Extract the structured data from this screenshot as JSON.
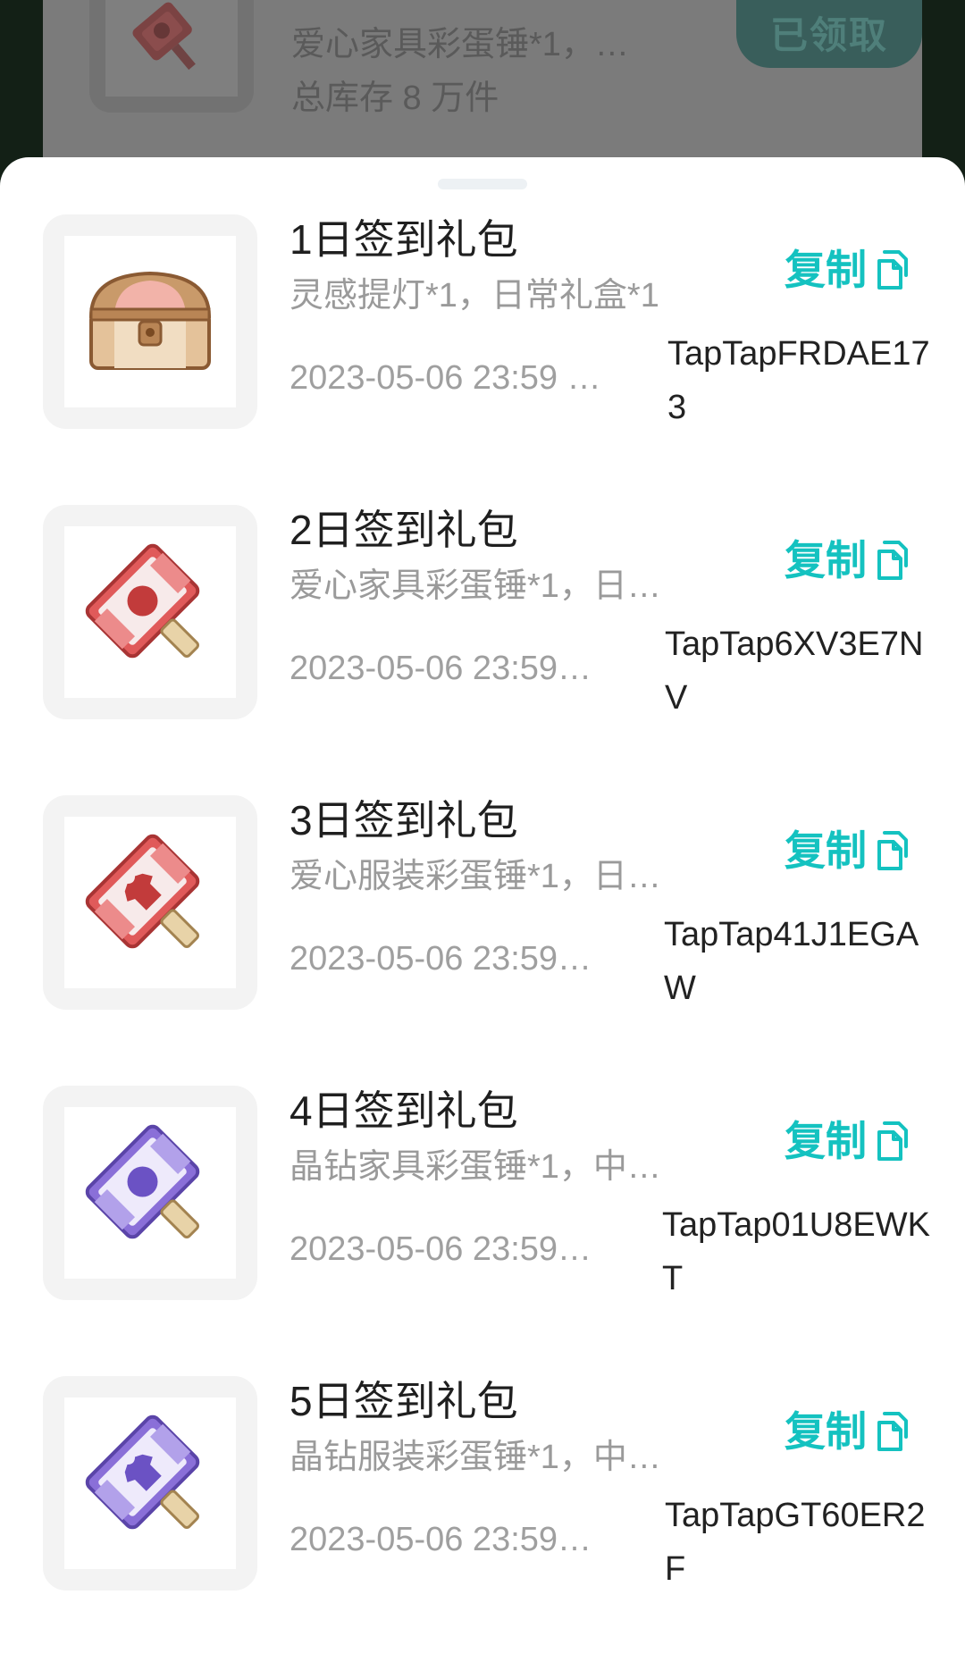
{
  "background": {
    "card": {
      "line1": "爱心家具彩蛋锤*1，…",
      "line2": "总库存 8 万件",
      "claimed_label": "已领取"
    }
  },
  "sheet": {
    "items": [
      {
        "title": "1日签到礼包",
        "desc": "灵感提灯*1，日常礼盒*1",
        "date": "2023-05-06 23:59 …",
        "code": "TapTapFRDAE173",
        "copy_label": "复制",
        "icon": "treasure-chest-icon",
        "accent": "#d9786f"
      },
      {
        "title": "2日签到礼包",
        "desc": "爱心家具彩蛋锤*1，日…",
        "date": "2023-05-06 23:59…",
        "code": "TapTap6XV3E7NV",
        "copy_label": "复制",
        "icon": "furniture-hammer-icon",
        "accent": "#e05a5a"
      },
      {
        "title": "3日签到礼包",
        "desc": "爱心服装彩蛋锤*1，日…",
        "date": "2023-05-06 23:59…",
        "code": "TapTap41J1EGAW",
        "copy_label": "复制",
        "icon": "clothing-hammer-icon",
        "accent": "#e05a5a"
      },
      {
        "title": "4日签到礼包",
        "desc": "晶钻家具彩蛋锤*1，中…",
        "date": "2023-05-06 23:59…",
        "code": "TapTap01U8EWKT",
        "copy_label": "复制",
        "icon": "furniture-hammer-icon",
        "accent": "#8a6fd8"
      },
      {
        "title": "5日签到礼包",
        "desc": "晶钻服装彩蛋锤*1，中…",
        "date": "2023-05-06 23:59…",
        "code": "TapTapGT60ER2F",
        "copy_label": "复制",
        "icon": "clothing-hammer-icon",
        "accent": "#8a6fd8"
      }
    ]
  },
  "colors": {
    "copy_accent": "#14c2c0"
  }
}
